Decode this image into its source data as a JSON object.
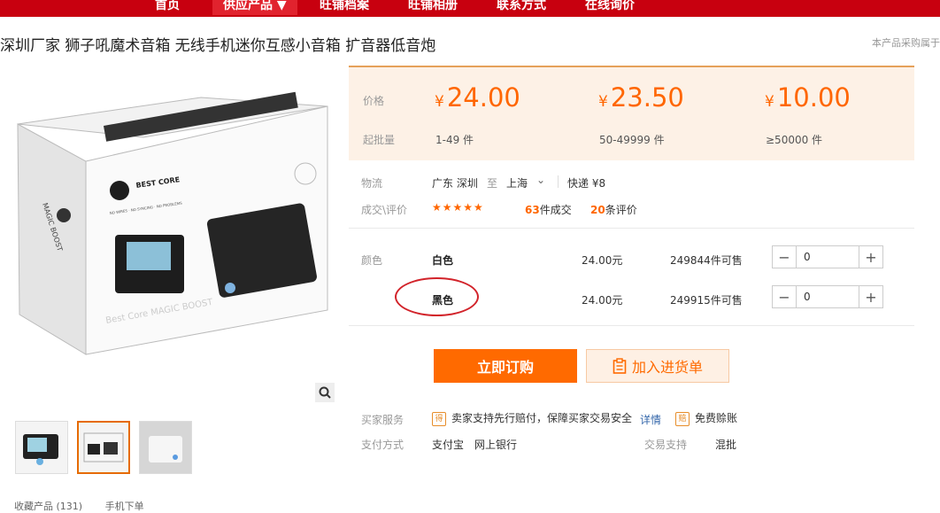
{
  "nav": {
    "items": [
      "首页",
      "供应产品 ▼",
      "旺铺档案",
      "旺铺相册",
      "联系方式",
      "在线询价"
    ]
  },
  "product": {
    "title": "深圳厂家 狮子吼魔术音箱 无线手机迷你互感小音箱 扩音器低音炮",
    "report_text": "本产品采购属于"
  },
  "pricing": {
    "price_label": "价格",
    "moq_label": "起批量",
    "currency": "¥",
    "tiers": [
      {
        "price": "24.00",
        "range": "1-49 件"
      },
      {
        "price": "23.50",
        "range": "50-49999 件"
      },
      {
        "price": "10.00",
        "range": "≥50000 件"
      }
    ]
  },
  "logistics": {
    "label": "物流",
    "from": "广东 深圳",
    "to_word": "至",
    "to": "上海",
    "express": "快递 ¥8"
  },
  "reviews": {
    "label": "成交\\评价",
    "stars": "★★★★★",
    "rating": 5,
    "deals_count": "63",
    "deals_suffix": "件成交",
    "reviews_count": "20",
    "reviews_suffix": "条评价"
  },
  "variants": {
    "label": "颜色",
    "items": [
      {
        "name": "白色",
        "price": "24.00元",
        "stock": "249844件可售",
        "qty": "0"
      },
      {
        "name": "黑色",
        "price": "24.00元",
        "stock": "249915件可售",
        "qty": "0"
      }
    ]
  },
  "actions": {
    "buy_now": "立即订购",
    "add_cart": "加入进货单"
  },
  "service": {
    "label": "买家服务",
    "badge1": "得",
    "text": "卖家支持先行赔付，保障买家交易安全",
    "detail_link": "详情",
    "badge2": "赔",
    "free": "免费赊账"
  },
  "payment": {
    "label": "支付方式",
    "methods": "支付宝　网上银行",
    "trade_label": "交易支持",
    "trade_value": "混批"
  },
  "gallery": {
    "box_brand": "BEST CORE",
    "box_tagline": "NO WIRES · NO SYNCING · NO PROBLEMS",
    "box_side": "MAGIC BOOST",
    "box_front_text": "Best Core\nMAGIC BOOST",
    "bottom_text": "收藏产品 (131)　　 手机下单"
  },
  "colors": {
    "brand_red": "#c8000f",
    "accent_orange": "#ff6600",
    "button_orange": "#ff6a00",
    "price_bg": "#fdf1e6"
  }
}
